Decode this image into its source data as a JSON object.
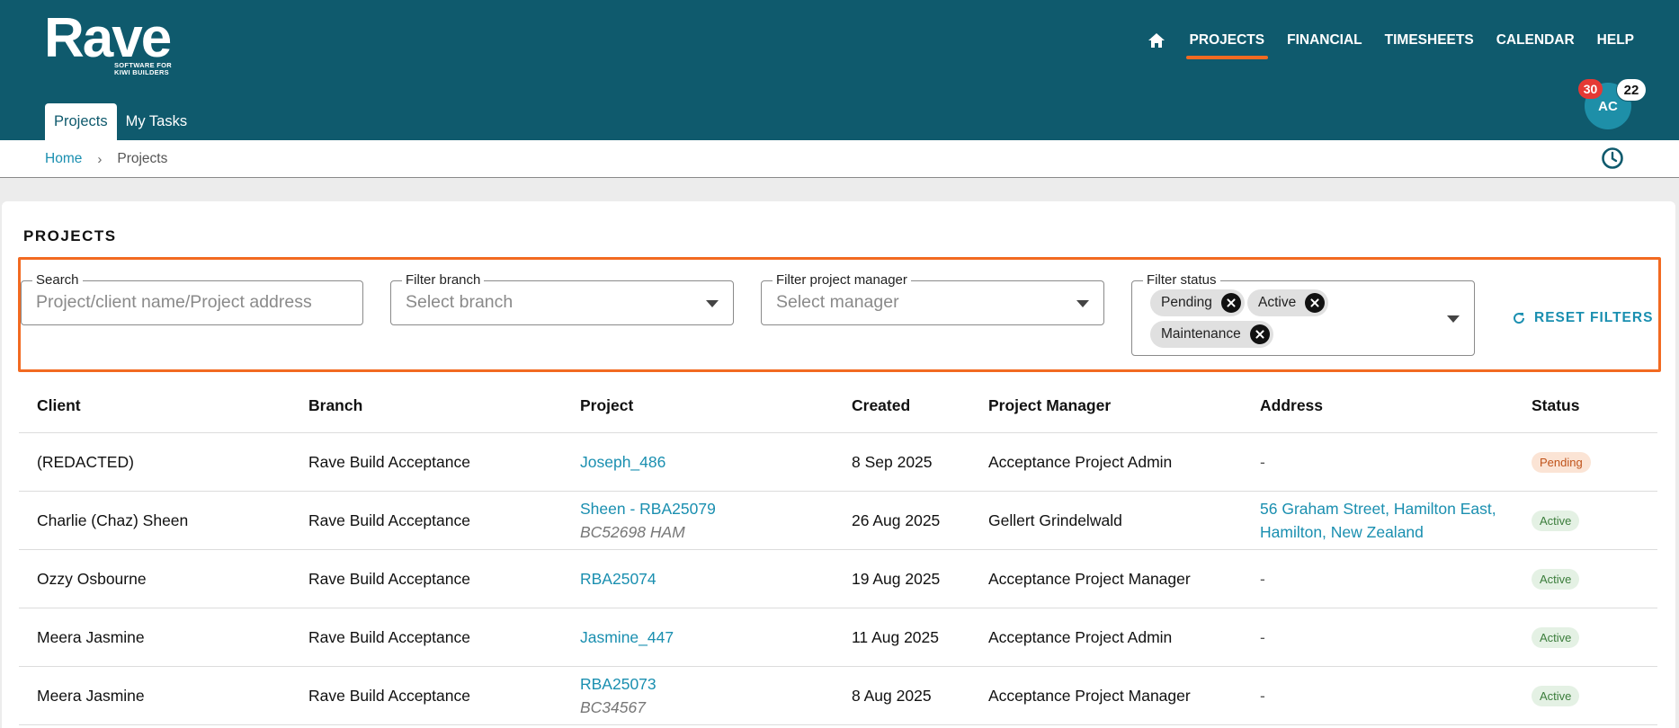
{
  "app": {
    "logo_word": "Rave",
    "logo_tagline_1": "SOFTWARE FOR",
    "logo_tagline_2": "KIWI BUILDERS"
  },
  "nav": {
    "home_icon": "home-icon",
    "items": [
      {
        "label": "PROJECTS",
        "active": true
      },
      {
        "label": "FINANCIAL"
      },
      {
        "label": "TIMESHEETS"
      },
      {
        "label": "CALENDAR"
      },
      {
        "label": "HELP"
      }
    ],
    "accent_color": "#f26a21",
    "header_color": "#0f5a6d"
  },
  "user": {
    "initials": "AC",
    "notifications_red": "30",
    "notifications_white": "22"
  },
  "subtabs": [
    {
      "label": "Projects",
      "active": true
    },
    {
      "label": "My Tasks"
    }
  ],
  "breadcrumb": {
    "home": "Home",
    "separator": "›",
    "current": "Projects",
    "history_icon": "clock-icon"
  },
  "page": {
    "title": "PROJECTS"
  },
  "filters": {
    "search": {
      "label": "Search",
      "placeholder": "Project/client name/Project address"
    },
    "branch": {
      "label": "Filter branch",
      "placeholder": "Select branch"
    },
    "manager": {
      "label": "Filter project manager",
      "placeholder": "Select manager"
    },
    "status": {
      "label": "Filter status",
      "chips": [
        "Pending",
        "Active",
        "Maintenance"
      ]
    },
    "reset_label": "RESET FILTERS"
  },
  "table": {
    "columns": [
      "Client",
      "Branch",
      "Project",
      "Created",
      "Project Manager",
      "Address",
      "Status"
    ],
    "rows": [
      {
        "client": "(REDACTED)",
        "branch": "Rave Build Acceptance",
        "project": "Joseph_486",
        "project_sub": "",
        "created": "8 Sep 2025",
        "pm": "Acceptance Project Admin",
        "address_1": "-",
        "address_2": "",
        "address_link": false,
        "status": "Pending"
      },
      {
        "client": "Charlie (Chaz) Sheen",
        "branch": "Rave Build Acceptance",
        "project": "Sheen - RBA25079",
        "project_sub": "BC52698 HAM",
        "created": "26 Aug 2025",
        "pm": "Gellert Grindelwald",
        "address_1": "56 Graham Street, Hamilton East,",
        "address_2": "Hamilton, New Zealand",
        "address_link": true,
        "status": "Active"
      },
      {
        "client": "Ozzy Osbourne",
        "branch": "Rave Build Acceptance",
        "project": "RBA25074",
        "project_sub": "",
        "created": "19 Aug 2025",
        "pm": "Acceptance Project Manager",
        "address_1": "-",
        "address_2": "",
        "address_link": false,
        "status": "Active"
      },
      {
        "client": "Meera Jasmine",
        "branch": "Rave Build Acceptance",
        "project": "Jasmine_447",
        "project_sub": "",
        "created": "11 Aug 2025",
        "pm": "Acceptance Project Admin",
        "address_1": "-",
        "address_2": "",
        "address_link": false,
        "status": "Active"
      },
      {
        "client": "Meera Jasmine",
        "branch": "Rave Build Acceptance",
        "project": "RBA25073",
        "project_sub": "BC34567",
        "created": "8 Aug 2025",
        "pm": "Acceptance Project Manager",
        "address_1": "-",
        "address_2": "",
        "address_link": false,
        "status": "Active"
      }
    ]
  }
}
